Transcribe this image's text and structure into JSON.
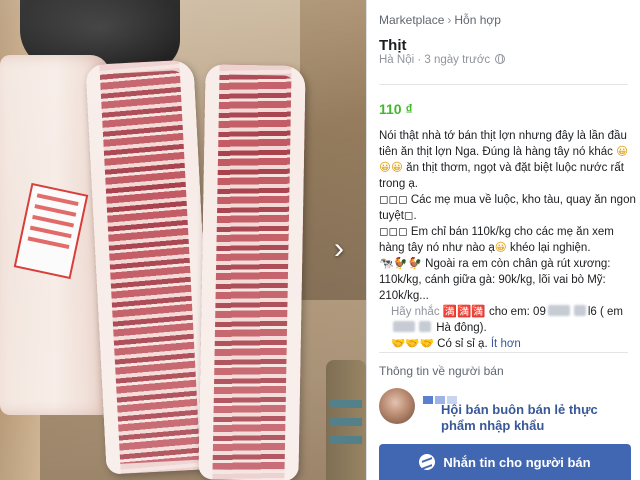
{
  "photo": {
    "next_icon": "chevron-right-icon",
    "next_glyph": "›"
  },
  "breadcrumb": {
    "first": "Marketplace",
    "separator": "›",
    "second": "Hỗn hợp"
  },
  "listing": {
    "title": "Thịt",
    "location": "Hà Nội",
    "time_sep": " · ",
    "posted": "3 ngày trước",
    "visibility_icon": "globe-icon",
    "price": "110 ₫",
    "price_color": "#42b72a"
  },
  "description": {
    "p1_a": "Nói thật nhà tớ bán thịt lợn nhưng  đây là lần đầu tiên ăn thịt lợn Nga. Đúng là hàng tây nó khác ",
    "p1_emoji": "😀😀😀",
    "p1_b": " ăn thịt thơm, ngọt và đặt biệt luộc nước rất trong ạ.",
    "p2": "◻◻◻ Các mẹ mua về luộc, kho tàu, quay ăn ngon tuyệt◻.",
    "p3_a": "◻◻◻ Em chỉ bán 110k/kg cho các mẹ ăn xem hàng tây nó như nào ạ",
    "p3_emoji": "😀",
    "p3_b": " khéo lại nghiện.",
    "p4_emoji": "🐄🐓🐓",
    "p4": " Ngoài ra em còn chân gà rút xương: 110k/kg, cánh giữa gà: 90k/kg, lõi vai bò Mỹ: 210k/kg...",
    "p5_a": "Hãy nhắc ",
    "p5_emoji": "🈵🈵🈵",
    "p5_b": " cho em: 09",
    "p5_c": "l6 ( em",
    "p6": " Hà đông).",
    "p7_emoji": "🤝🤝🤝",
    "p7": " Có sỉ sỉ ạ.",
    "less_link": "Ít hơn"
  },
  "seller": {
    "heading": "Thông tin về người bán",
    "name": "Hội bán buôn bán lẻ thực phẩm nhập khẩu"
  },
  "actions": {
    "message_button": "Nhắn tin cho người bán",
    "message_icon": "messenger-icon",
    "brand_color": "#4267b2"
  }
}
